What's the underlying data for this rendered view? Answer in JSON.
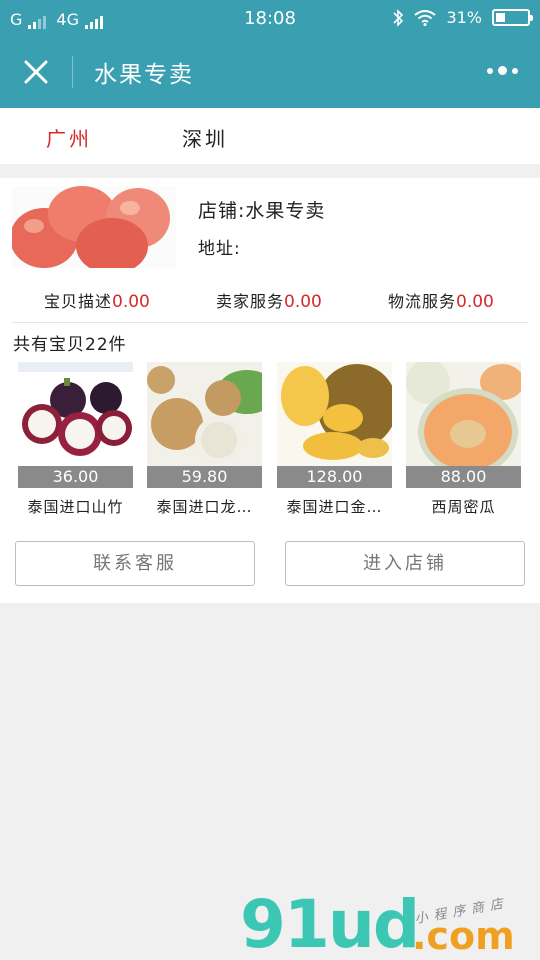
{
  "status": {
    "carrier": "G",
    "network": "4G",
    "time": "18:08",
    "battery": "31%",
    "battery_level": 0.31
  },
  "nav": {
    "title": "水果专卖"
  },
  "tabs": [
    {
      "label": "广州",
      "active": true
    },
    {
      "label": "深圳",
      "active": false
    }
  ],
  "store": {
    "name": "店铺:水果专卖",
    "address": "地址:"
  },
  "ratings": [
    {
      "label": "宝贝描述",
      "value": "0.00"
    },
    {
      "label": "卖家服务",
      "value": "0.00"
    },
    {
      "label": "物流服务",
      "value": "0.00"
    }
  ],
  "product_count": "共有宝贝22件",
  "products": [
    {
      "price": "36.00",
      "name": "泰国进口山竹"
    },
    {
      "price": "59.80",
      "name": "泰国进口龙…"
    },
    {
      "price": "128.00",
      "name": "泰国进口金…"
    },
    {
      "price": "88.00",
      "name": "西周密瓜"
    }
  ],
  "buttons": {
    "contact": "联系客服",
    "enter_store": "进入店铺"
  },
  "watermark": {
    "logo": "91ud",
    "domain": ".com",
    "tagline": "小程序商店"
  },
  "colors": {
    "header": "#3aa0b1",
    "accent_red": "#d42a2a",
    "watermark_green": "#3cc7b4",
    "watermark_orange": "#f0a020"
  }
}
